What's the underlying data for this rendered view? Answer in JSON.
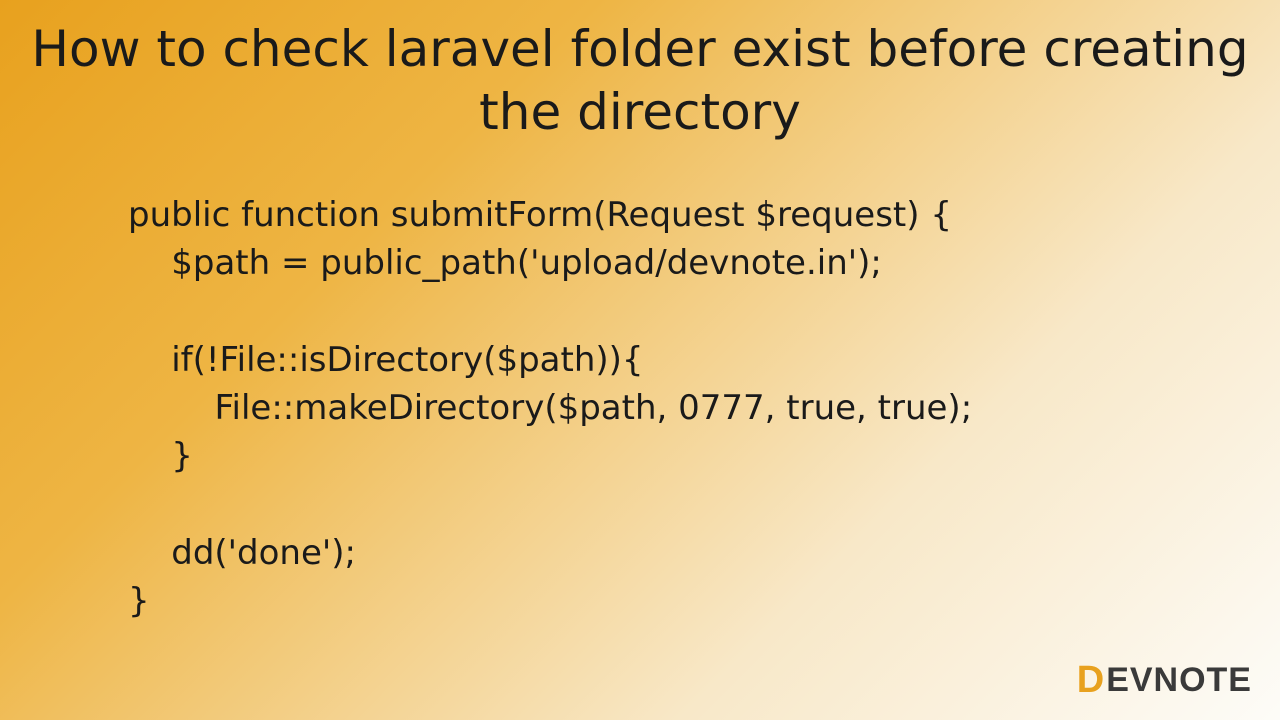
{
  "title": "How to check laravel folder exist before\ncreating the directory",
  "code": "public function submitForm(Request $request) {\n    $path = public_path('upload/devnote.in');\n\n    if(!File::isDirectory($path)){\n        File::makeDirectory($path, 0777, true, true);\n    }\n\n    dd('done');\n}",
  "logo": {
    "d": "D",
    "rest": "EVNOTE"
  }
}
